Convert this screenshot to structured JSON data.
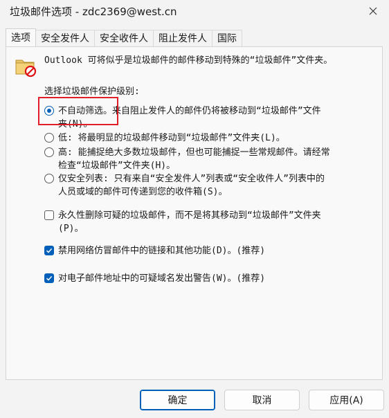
{
  "window": {
    "title": "垃圾邮件选项 - zdc2369@west.cn",
    "close_icon": "close-icon"
  },
  "tabs": [
    {
      "label": "选项",
      "active": true
    },
    {
      "label": "安全发件人",
      "active": false
    },
    {
      "label": "安全收件人",
      "active": false
    },
    {
      "label": "阻止发件人",
      "active": false
    },
    {
      "label": "国际",
      "active": false
    }
  ],
  "options_page": {
    "intro_icon": "junk-folder-icon",
    "intro": "Outlook 可将似乎是垃圾邮件的邮件移动到特殊的“垃圾邮件”文件夹。",
    "level_label": "选择垃圾邮件保护级别:",
    "levels": [
      {
        "line1": "不自动筛选。来自阻止发件人的邮件仍将被移动到“垃圾邮件”文件",
        "line2": "夹(N)。",
        "checked": true
      },
      {
        "line1": "低: 将最明显的垃圾邮件移动到“垃圾邮件”文件夹(L)。",
        "line2": "",
        "checked": false
      },
      {
        "line1": "高: 能捕捉绝大多数垃圾邮件，但也可能捕捉一些常规邮件。请经常",
        "line2": "检查“垃圾邮件”文件夹(H)。",
        "checked": false
      },
      {
        "line1": "仅安全列表: 只有来自“安全发件人”列表或“安全收件人”列表中的",
        "line2": "人员或域的邮件可传递到您的收件箱(S)。",
        "checked": false
      }
    ],
    "checkboxes": [
      {
        "line1": "永久性删除可疑的垃圾邮件，而不是将其移动到“垃圾邮件”文件夹",
        "line2": "(P)。",
        "checked": false
      },
      {
        "line1": "禁用网络仿冒邮件中的链接和其他功能(D)。(推荐)",
        "line2": "",
        "checked": true
      },
      {
        "line1": "对电子邮件地址中的可疑域名发出警告(W)。(推荐)",
        "line2": "",
        "checked": true
      }
    ]
  },
  "buttons": {
    "ok": "确定",
    "cancel": "取消",
    "apply": "应用(A)"
  },
  "colors": {
    "accent": "#005fb8",
    "highlight": "#e11d2a"
  }
}
